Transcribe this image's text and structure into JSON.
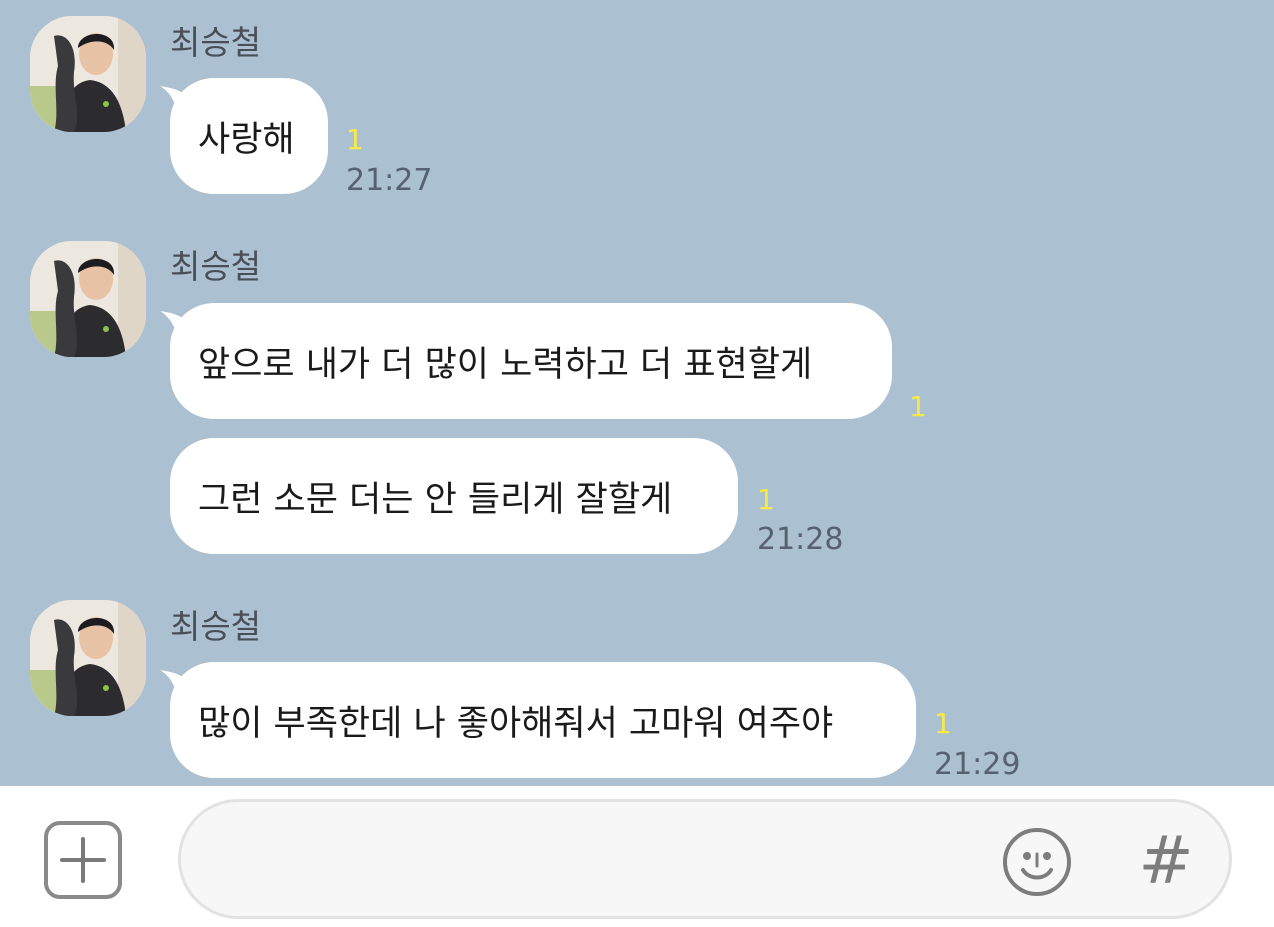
{
  "chat": {
    "groups": [
      {
        "sender": "최승철",
        "messages": [
          {
            "text": "사랑해",
            "unread": "1",
            "time": "21:27"
          }
        ]
      },
      {
        "sender": "최승철",
        "messages": [
          {
            "text": "앞으로 내가 더 많이 노력하고 더 표현할게",
            "unread": "1",
            "time": ""
          },
          {
            "text": "그런 소문 더는 안 들리게 잘할게",
            "unread": "1",
            "time": "21:28"
          }
        ]
      },
      {
        "sender": "최승철",
        "messages": [
          {
            "text": "많이 부족한데 나 좋아해줘서 고마워 여주야",
            "unread": "1",
            "time": "21:29"
          }
        ]
      }
    ]
  },
  "input_bar": {
    "plus_icon": "plus-square-icon",
    "emoji_icon": "smiley-icon",
    "hash_label": "#",
    "message_value": "",
    "placeholder": ""
  },
  "colors": {
    "chat_background": "#abc0d1",
    "unread_count": "#f6e94a",
    "bubble": "#ffffff"
  }
}
